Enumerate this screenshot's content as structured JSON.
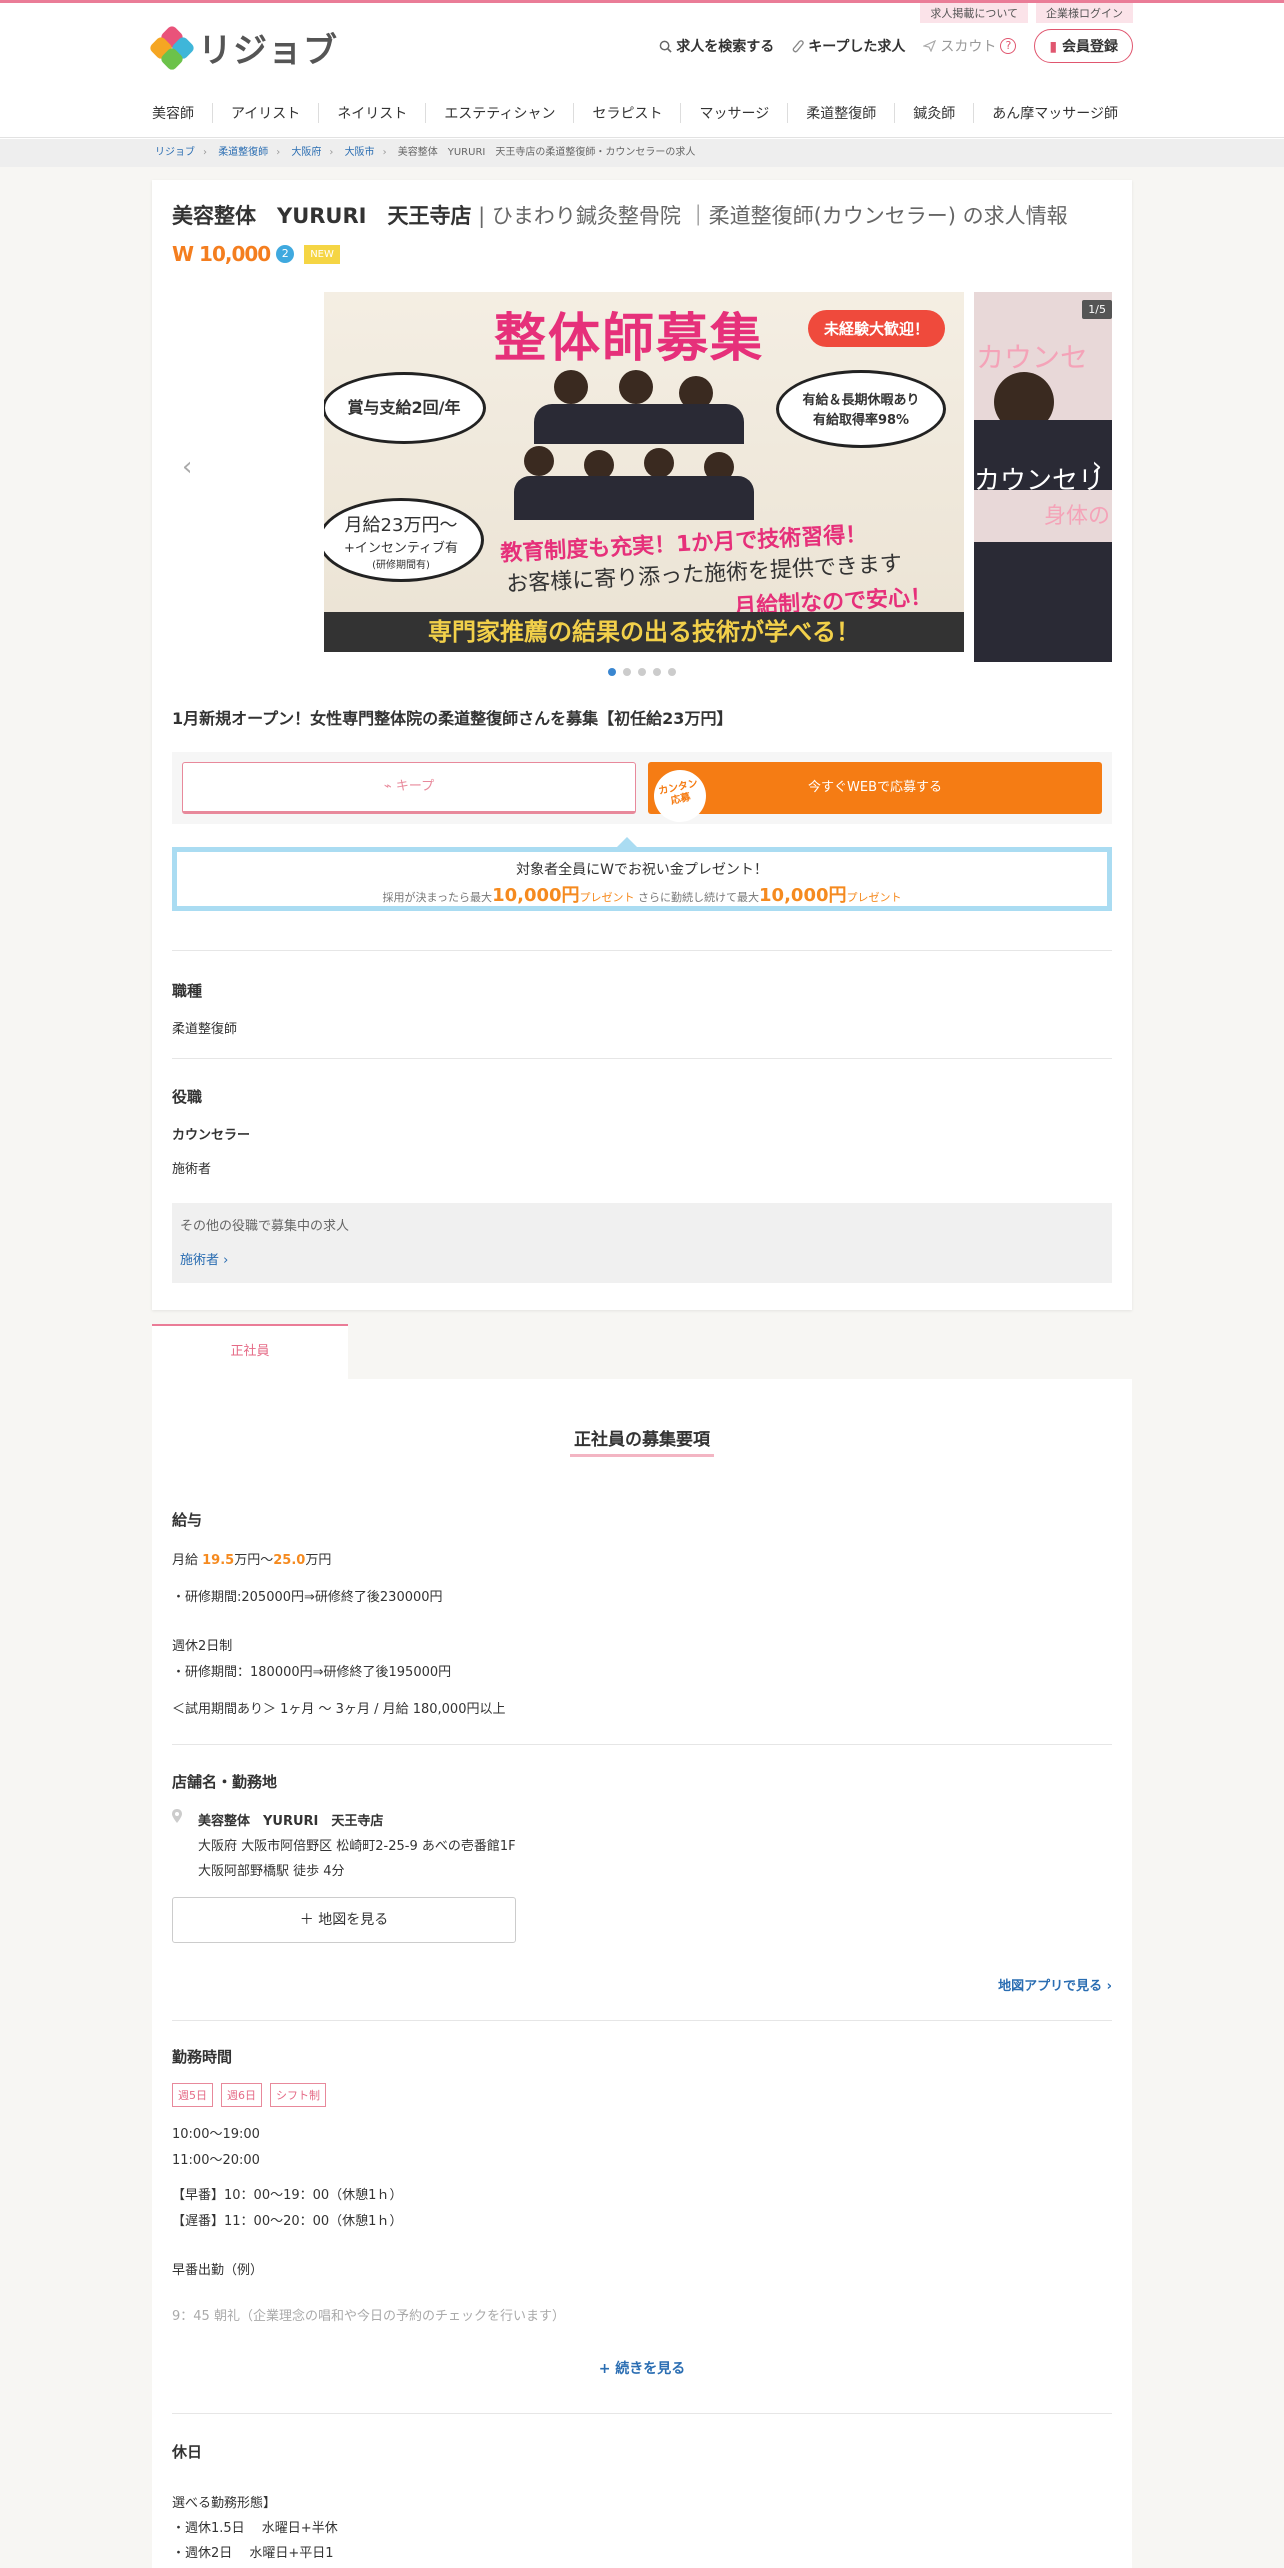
{
  "top_links": [
    "求人掲載について",
    "企業様ログイン"
  ],
  "logo_text": "リジョブ",
  "header_nav": {
    "search": "求人を検索する",
    "kept": "キープした求人",
    "scout": "スカウト",
    "help": "?",
    "register": "会員登録"
  },
  "categories": [
    "美容師",
    "アイリスト",
    "ネイリスト",
    "エステティシャン",
    "セラピスト",
    "マッサージ",
    "柔道整復師",
    "鍼灸師",
    "あん摩マッサージ師"
  ],
  "breadcrumbs": [
    "リジョブ",
    "柔道整復師",
    "大阪府",
    "大阪市",
    "美容整体　YURURI　天王寺店の柔道整復師・カウンセラーの求人"
  ],
  "job": {
    "shop_name": "美容整体　YURURI　天王寺店",
    "subtitle": "| ひまわり鍼灸整骨院 ｜柔道整復師(カウンセラー) の求人情報",
    "w_badge": "W 10,000",
    "w_badge_num": "2",
    "new_label": "NEW",
    "slide_counter": "1/5",
    "slide": {
      "banner": "整体師募集",
      "welcome": "未経験大歓迎！",
      "bubble_bonus": "賞与支給2回/年",
      "bubble_leave_1": "有給＆長期休暇あり",
      "bubble_leave_2": "有給取得率98%",
      "bubble_salary_1": "月給23万円〜",
      "bubble_salary_2": "+インセンティブ有",
      "bubble_salary_3": "(研修期間有)",
      "line1": "教育制度も充実！1か月で技術習得！",
      "line2": "お客様に寄り添った施術を提供できます",
      "line3": "月給制なので安心！",
      "line4": "専門家推薦の結果の出る技術が学べる！",
      "next_1": "カウンセ",
      "next_2": "カウンセリ",
      "next_3": "身体の"
    },
    "headline": "1月新規オープン！女性専門整体院の柔道整復師さんを募集【初任給23万円】",
    "keep_label": "キープ",
    "apply_label": "今すぐWEBで応募する",
    "kantan_1": "カンタン",
    "kantan_2": "応募",
    "present": {
      "t1": "対象者全員にWでお祝い金プレゼント！",
      "a": "採用が決まったら最大",
      "amt1": "10,000円",
      "b": "プレゼント",
      "c": " さらに勤続し続けて最大",
      "amt2": "10,000円",
      "d": "プレゼント"
    },
    "occupation_h": "職種",
    "occupation": "柔道整復師",
    "role_h": "役職",
    "role_1": "カウンセラー",
    "role_2": "施術者",
    "other_roles_label": "その他の役職で募集中の求人",
    "other_roles_link": "施術者 ›"
  },
  "tab_label": "正社員",
  "details": {
    "heading": "正社員の募集要項",
    "salary_h": "給与",
    "salary_pre": "月給 ",
    "salary_min": "19.5",
    "salary_mid": "万円〜",
    "salary_max": "25.0",
    "salary_post": "万円",
    "salary_l1": "・研修期間:205000円⇒研修終了後230000円",
    "salary_l2": "週休2日制",
    "salary_l3": "・研修期間：180000円⇒研修終了後195000円",
    "salary_l4": "＜試用期間あり＞ 1ヶ月 〜 3ヶ月 / 月給 180,000円以上",
    "store_h": "店舗名・勤務地",
    "store_name": "美容整体　YURURI　天王寺店",
    "address": "大阪府 大阪市阿倍野区 松崎町2-25-9 あべの壱番館1F",
    "station": "大阪阿部野橋駅 徒歩 4分",
    "map_btn": "＋ 地図を見る",
    "map_app": "地図アプリで見る ›",
    "hours_h": "勤務時間",
    "tags": [
      "週5日",
      "週6日",
      "シフト制"
    ],
    "h1": "10:00〜19:00",
    "h2": "11:00〜20:00",
    "h3": "【早番】10：00～19：00（休憩1ｈ）",
    "h4": "【遅番】11：00～20：00（休憩1ｈ）",
    "h5": "早番出勤（例）",
    "h6": "9：45 朝礼（企業理念の唱和や今日の予約のチェックを行います）",
    "more": "+ 続きを見る",
    "holiday_h": "休日",
    "hol1": "選べる勤務形態】",
    "hol2": "・週休1.5日　 水曜日+半休",
    "hol3": "・週休2日　 水曜日+平日1"
  },
  "colors": {
    "accent_pink": "#e8899b",
    "apply_orange": "#f57c14",
    "link_blue": "#2a6db2",
    "present_blue": "#aadcf2"
  }
}
